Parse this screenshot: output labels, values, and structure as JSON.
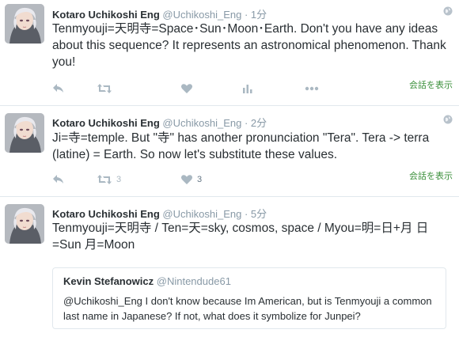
{
  "author": {
    "name": "Kotaro Uchikoshi Eng",
    "handle": "@Uchikoshi_Eng"
  },
  "tweets": [
    {
      "time": "1分",
      "text": "Tenmyouji=天明寺=Space･Sun･Moon･Earth. Don't you have any ideas about this sequence? It represents an astronomical phenomenon. Thank you!",
      "retweet_count": "",
      "like_count": "",
      "conversation_label": "会話を表示"
    },
    {
      "time": "2分",
      "text": "Ji=寺=temple. But \"寺\" has another pronunciation \"Tera\". Tera -> terra (latine) = Earth. So now let's substitute these values.",
      "retweet_count": "3",
      "like_count": "3",
      "conversation_label": "会話を表示"
    },
    {
      "time": "5分",
      "text": "Tenmyouji=天明寺 / Ten=天=sky, cosmos, space / Myou=明=日+月 日=Sun 月=Moon",
      "quote": {
        "name": "Kevin Stefanowicz",
        "handle": "@Nintendude61",
        "text": "@Uchikoshi_Eng I don't know because Im American, but is Tenmyouji a common last name in Japanese? If not, what does it symbolize for Junpei?"
      }
    }
  ],
  "separator": " · ",
  "colors": {
    "text": "#292f33",
    "muted": "#8899a6",
    "icon": "#aab8c2",
    "border": "#e1e8ed",
    "conversation_link": "#3a8f3a"
  },
  "icons": [
    "reply-icon",
    "retweet-icon",
    "like-icon",
    "analytics-icon",
    "more-icon",
    "globe-icon",
    "avatar"
  ]
}
